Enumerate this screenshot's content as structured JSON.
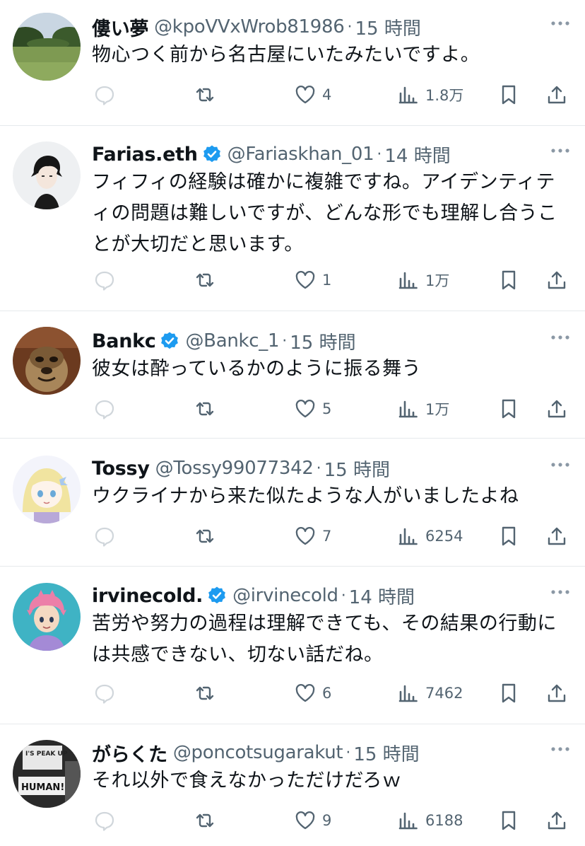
{
  "tweets": [
    {
      "name": "僂い夢",
      "verified": false,
      "handle": "@kpoVVxWrob81986",
      "time": "15 時間",
      "text": "物心つく前から名古屋にいたみたいですよ。",
      "replies": "",
      "retweets": "",
      "likes": "4",
      "views": "1.8万",
      "avatar": "avatar-golf-course"
    },
    {
      "name": "Farias.eth",
      "verified": true,
      "handle": "@Fariaskhan_01",
      "time": "14 時間",
      "text": "フィフィの経験は確かに複雑ですね。アイデンティティの問題は難しいですが、どんな形でも理解し合うことが大切だと思います。",
      "replies": "",
      "retweets": "",
      "likes": "1",
      "views": "1万",
      "avatar": "avatar-anime-boy"
    },
    {
      "name": "Bankc",
      "verified": true,
      "handle": "@Bankc_1",
      "time": "15 時間",
      "text": "彼女は酔っているかのように振る舞う",
      "replies": "",
      "retweets": "",
      "likes": "5",
      "views": "1万",
      "avatar": "avatar-meerkat"
    },
    {
      "name": "Tossy",
      "verified": false,
      "handle": "@Tossy99077342",
      "time": "15 時間",
      "text": "ウクライナから来た似たような人がいましたよね",
      "replies": "",
      "retweets": "",
      "likes": "7",
      "views": "6254",
      "avatar": "avatar-anime-girl"
    },
    {
      "name": "irvinecold.",
      "verified": true,
      "handle": "@irvinecold",
      "time": "14 時間",
      "text": "苦労や努力の過程は理解できても、その結果の行動には共感できない、切ない話だね。",
      "replies": "",
      "retweets": "",
      "likes": "6",
      "views": "7462",
      "avatar": "avatar-pink-hair"
    },
    {
      "name": "がらくた",
      "verified": false,
      "handle": "@poncotsugarakut",
      "time": "15 時間",
      "text": "それ以外で食えなかっただけだろｗ",
      "replies": "",
      "retweets": "",
      "likes": "9",
      "views": "6188",
      "avatar": "avatar-protest-sign",
      "avatar_sign_top": "I'S PEAK UP",
      "avatar_sign_bottom": "HUMAN!!"
    }
  ],
  "colors": {
    "verified": "#1d9bf0",
    "muted": "#536471",
    "text": "#0f1419",
    "divider": "#e6e9ec"
  }
}
